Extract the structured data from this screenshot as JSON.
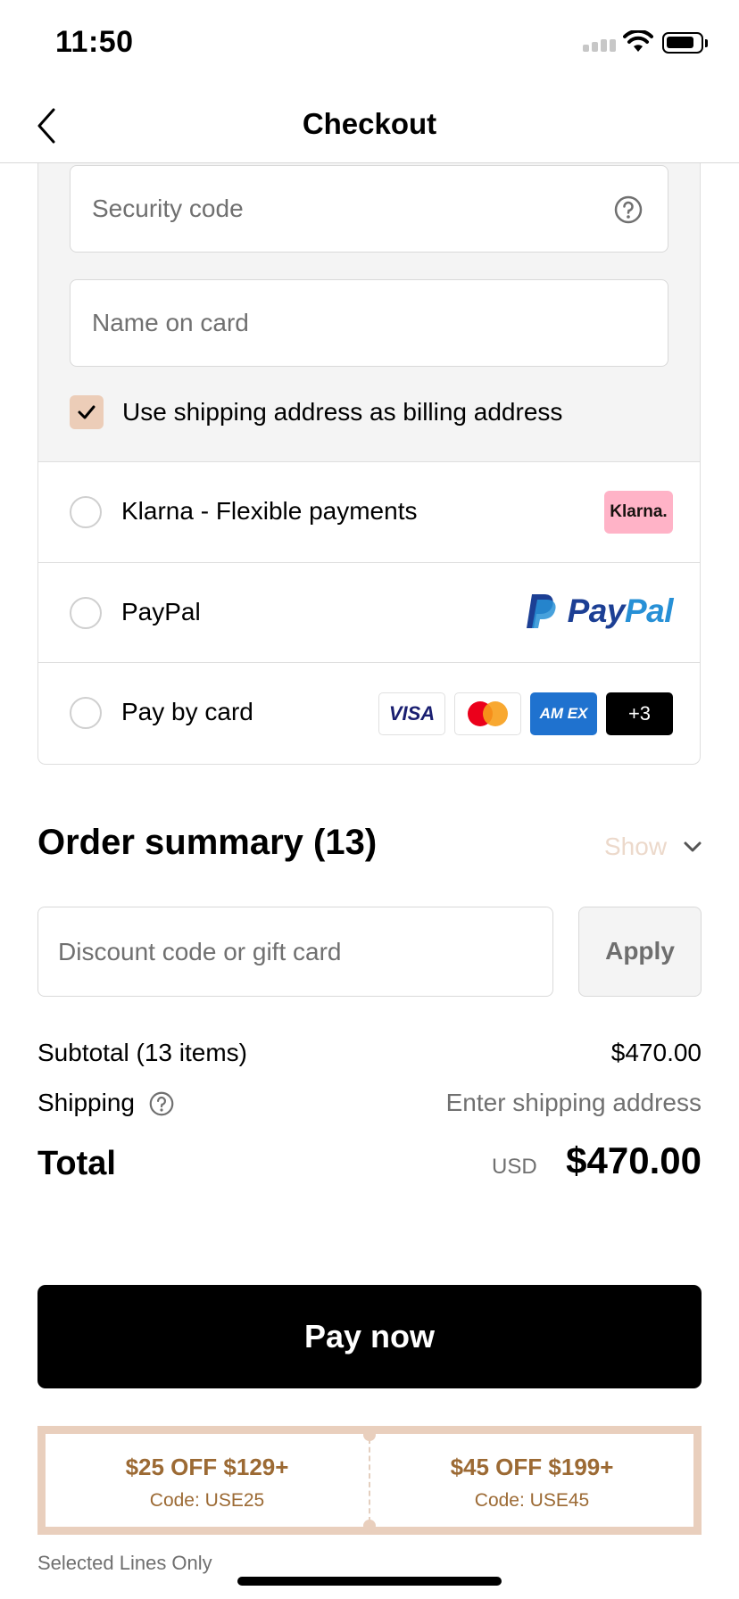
{
  "status_bar": {
    "time": "11:50"
  },
  "nav": {
    "title": "Checkout"
  },
  "card_form": {
    "security_code_placeholder": "Security code",
    "name_placeholder": "Name on card",
    "billing_checkbox_label": "Use shipping address as billing address",
    "billing_checkbox_checked": true
  },
  "payment_methods": [
    {
      "label": "Klarna - Flexible payments",
      "logo_text": "Klarna.",
      "selected": false
    },
    {
      "label": "PayPal",
      "logo_text_1": "Pay",
      "logo_text_2": "Pal",
      "selected": false
    },
    {
      "label": "Pay by card",
      "selected": false,
      "card_logos": {
        "visa": "VISA",
        "amex": "AM EX",
        "more": "+3"
      }
    }
  ],
  "order_summary": {
    "title": "Order summary (13)",
    "toggle_label": "Show",
    "discount_placeholder": "Discount code or gift card",
    "apply_label": "Apply",
    "subtotal_label": "Subtotal (13 items)",
    "subtotal_value": "$470.00",
    "shipping_label": "Shipping",
    "shipping_value": "Enter shipping address",
    "total_label": "Total",
    "currency": "USD",
    "total_value": "$470.00"
  },
  "pay_button_label": "Pay now",
  "coupons": [
    {
      "headline": "$25 OFF $129+",
      "code": "Code: USE25"
    },
    {
      "headline": "$45 OFF $199+",
      "code": "Code: USE45"
    }
  ],
  "fine_print": "Selected Lines Only",
  "colors": {
    "accent_tan": "#e9cfbd",
    "coupon_text": "#9c6a34",
    "klarna_pink": "#ffb3c7",
    "paypal_dark": "#1c3f94",
    "paypal_light": "#2790d6",
    "amex_blue": "#1f72cf"
  }
}
